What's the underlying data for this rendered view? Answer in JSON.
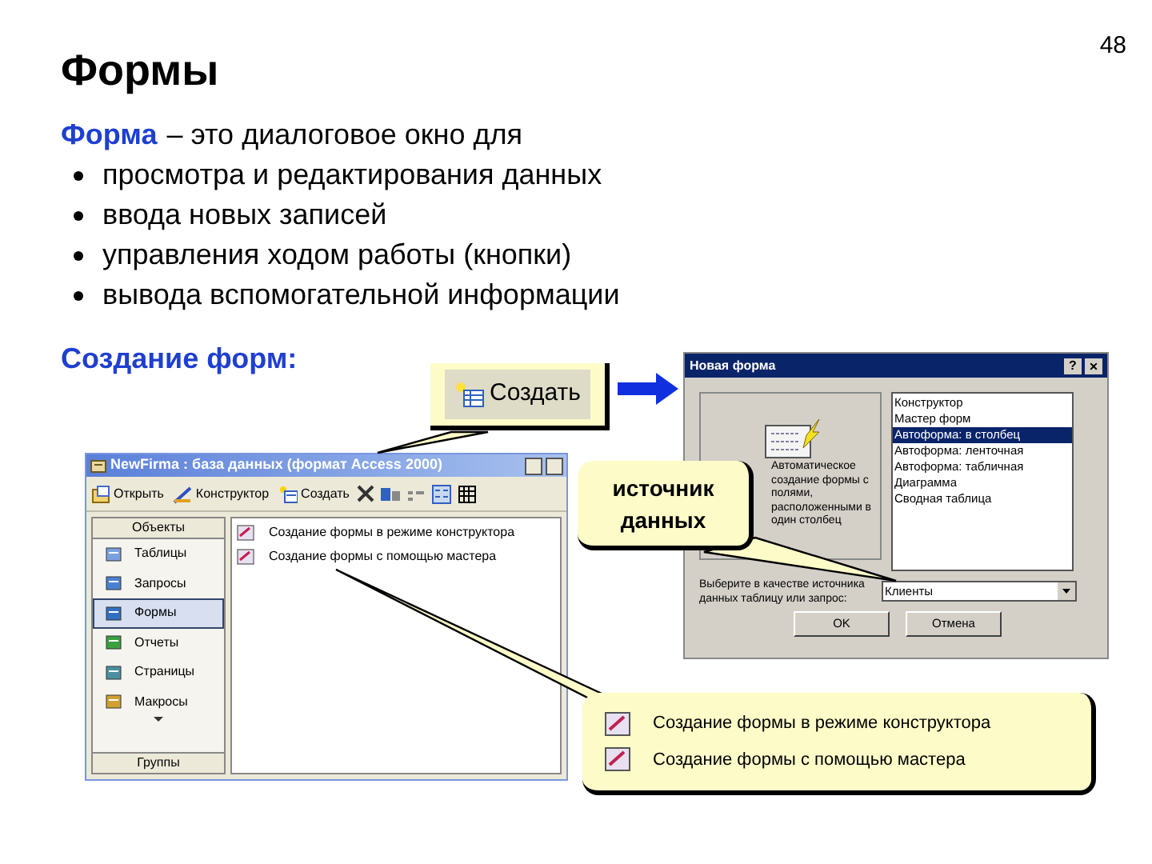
{
  "page_number": "48",
  "title": "Формы",
  "definition": {
    "term": "Форма",
    "text": "– это диалоговое окно для"
  },
  "bullets": [
    "просмотра и редактирования данных",
    "ввода новых записей",
    "управления ходом работы (кнопки)",
    "вывода вспомогательной информации"
  ],
  "subheading": "Создание форм:",
  "create_callout": {
    "label": "Создать"
  },
  "access_window": {
    "title": "NewFirma : база данных (формат Access 2000)",
    "toolbar": [
      "Открыть",
      "Конструктор",
      "Создать"
    ],
    "objects_header": "Объекты",
    "objects": [
      {
        "label": "Таблицы",
        "selected": false
      },
      {
        "label": "Запросы",
        "selected": false
      },
      {
        "label": "Формы",
        "selected": true
      },
      {
        "label": "Отчеты",
        "selected": false
      },
      {
        "label": "Страницы",
        "selected": false
      },
      {
        "label": "Макросы",
        "selected": false
      }
    ],
    "groups": "Группы",
    "items": [
      "Создание формы в режиме конструктора",
      "Создание формы с помощью мастера"
    ]
  },
  "dialog": {
    "title": "Новая форма",
    "help": "?",
    "close": "×",
    "description": "Автоматическое создание формы с полями, расположенными в один столбец",
    "options": [
      {
        "label": "Конструктор",
        "selected": false
      },
      {
        "label": "Мастер форм",
        "selected": false
      },
      {
        "label": "Автоформа: в столбец",
        "selected": true
      },
      {
        "label": "Автоформа: ленточная",
        "selected": false
      },
      {
        "label": "Автоформа: табличная",
        "selected": false
      },
      {
        "label": "Диаграмма",
        "selected": false
      },
      {
        "label": "Сводная таблица",
        "selected": false
      }
    ],
    "source_label": "Выберите в качестве источника данных таблицу или запрос:",
    "source_value": "Клиенты",
    "buttons": [
      "OK",
      "Отмена"
    ]
  },
  "source_callout": {
    "text": "источник данных"
  },
  "wizard_callout": {
    "items": [
      "Создание формы в режиме конструктора",
      "Создание формы с помощью мастера"
    ]
  }
}
